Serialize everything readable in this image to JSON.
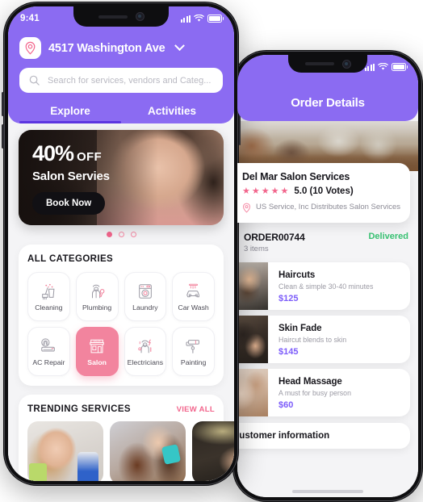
{
  "phone_explore": {
    "status_bar": {
      "time": "9:41",
      "signal_icon": "cellular-signal-icon",
      "wifi_icon": "wifi-icon",
      "battery_icon": "battery-icon"
    },
    "location": {
      "icon": "location-pin-icon",
      "address": "4517 Washington Ave",
      "chevron_icon": "chevron-down-icon"
    },
    "search": {
      "icon": "search-icon",
      "placeholder": "Search for services, vendors and Categ...",
      "value": ""
    },
    "tabs": [
      {
        "label": "Explore",
        "active": true
      },
      {
        "label": "Activities",
        "active": false
      }
    ],
    "banner": {
      "discount": "40%",
      "off_label": "OFF",
      "subtitle": "Salon Servies",
      "cta": "Book Now",
      "dots": 3,
      "active_dot": 1
    },
    "categories_section": {
      "title": "ALL CATEGORIES",
      "items": [
        {
          "label": "Cleaning",
          "icon": "cleaning-bucket-icon",
          "selected": false
        },
        {
          "label": "Plumbing",
          "icon": "plumber-wrench-icon",
          "selected": false
        },
        {
          "label": "Laundry",
          "icon": "washing-machine-icon",
          "selected": false
        },
        {
          "label": "Car Wash",
          "icon": "car-wash-icon",
          "selected": false
        },
        {
          "label": "AC Repair",
          "icon": "air-conditioner-icon",
          "selected": false
        },
        {
          "label": "Salon",
          "icon": "salon-storefront-icon",
          "selected": true
        },
        {
          "label": "Electricians",
          "icon": "electrician-icon",
          "selected": false
        },
        {
          "label": "Painting",
          "icon": "paint-roller-icon",
          "selected": false
        }
      ]
    },
    "trending_section": {
      "title": "TRENDING SERVICES",
      "view_all": "VIEW ALL",
      "cards": [
        {
          "image": "woman-with-spray-bottle-photo"
        },
        {
          "image": "hair-styling-salon-photo"
        },
        {
          "image": "technician-working-photo"
        }
      ]
    }
  },
  "phone_order": {
    "status_bar": {
      "signal_icon": "cellular-signal-icon",
      "wifi_icon": "wifi-icon",
      "battery_icon": "battery-icon"
    },
    "title": "Order Details",
    "hero_image": "salon-interior-photo",
    "business": {
      "name": "Del Mar Salon Services",
      "stars": 5,
      "rating": "5.0 (10 Votes)",
      "location_icon": "location-pin-icon",
      "description": "US Service, Inc Distributes Salon Services"
    },
    "order": {
      "id": "ORDER00744",
      "items_count": "3 items",
      "status": "Delivered"
    },
    "services": [
      {
        "name": "Haircuts",
        "desc": "Clean & simple 30-40 minutes",
        "price": "$125",
        "image": "haircut-photo"
      },
      {
        "name": "Skin Fade",
        "desc": "Haircut blends to skin",
        "price": "$145",
        "image": "skin-fade-photo"
      },
      {
        "name": "Head Massage",
        "desc": "A must for busy person",
        "price": "$60",
        "image": "head-massage-photo"
      }
    ],
    "footer_section": {
      "title": "Customer information"
    }
  },
  "colors": {
    "purple": "#8b6bf2",
    "purple_dark": "#5c35e0",
    "pink": "#f2658c",
    "pink_soft": "#f2849e",
    "green": "#38c172",
    "price_purple": "#7c5cfa"
  }
}
